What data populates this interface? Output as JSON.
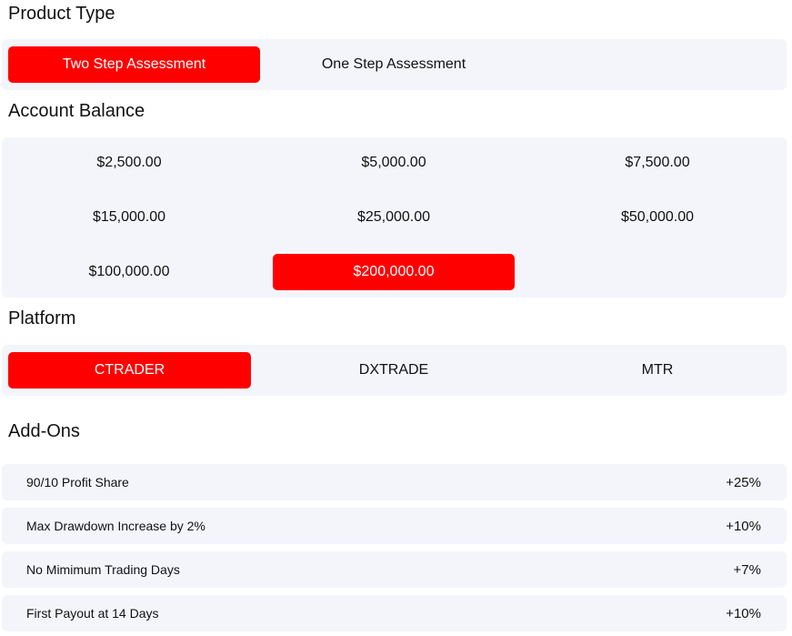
{
  "product_type": {
    "title": "Product Type",
    "options": [
      "Two Step Assessment",
      "One Step Assessment"
    ],
    "selected": "Two Step Assessment"
  },
  "account_balance": {
    "title": "Account Balance",
    "options": [
      "$2,500.00",
      "$5,000.00",
      "$7,500.00",
      "$15,000.00",
      "$25,000.00",
      "$50,000.00",
      "$100,000.00",
      "$200,000.00"
    ],
    "selected": "$200,000.00"
  },
  "platform": {
    "title": "Platform",
    "options": [
      "CTRADER",
      "DXTRADE",
      "MTR"
    ],
    "selected": "CTRADER"
  },
  "addons": {
    "title": "Add-Ons",
    "items": [
      {
        "label": "90/10 Profit Share",
        "value": "+25%"
      },
      {
        "label": "Max Drawdown Increase by 2%",
        "value": "+10%"
      },
      {
        "label": "No Mimimum Trading Days",
        "value": "+7%"
      },
      {
        "label": "First Payout at 14 Days",
        "value": "+10%"
      }
    ]
  },
  "colors": {
    "accent": "#ff0000",
    "panel_bg": "#f3f5fb"
  }
}
